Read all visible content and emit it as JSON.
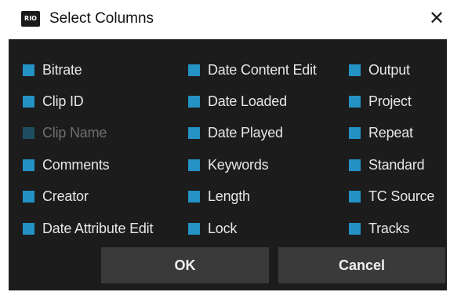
{
  "window": {
    "app_icon_text": "RIO",
    "title": "Select Columns",
    "close_glyph": "✕"
  },
  "colors": {
    "checkbox": "#2492c5",
    "checkbox_disabled": "#1e4d60",
    "background": "#1c1c1c",
    "button": "#3a3a3a"
  },
  "columns": [
    [
      {
        "label": "Bitrate",
        "checked": true,
        "enabled": true
      },
      {
        "label": "Clip ID",
        "checked": true,
        "enabled": true
      },
      {
        "label": "Clip Name",
        "checked": true,
        "enabled": false
      },
      {
        "label": "Comments",
        "checked": true,
        "enabled": true
      },
      {
        "label": "Creator",
        "checked": true,
        "enabled": true
      },
      {
        "label": "Date Attribute Edit",
        "checked": true,
        "enabled": true
      }
    ],
    [
      {
        "label": "Date Content Edit",
        "checked": true,
        "enabled": true
      },
      {
        "label": "Date Loaded",
        "checked": true,
        "enabled": true
      },
      {
        "label": "Date Played",
        "checked": true,
        "enabled": true
      },
      {
        "label": "Keywords",
        "checked": true,
        "enabled": true
      },
      {
        "label": "Length",
        "checked": true,
        "enabled": true
      },
      {
        "label": "Lock",
        "checked": true,
        "enabled": true
      }
    ],
    [
      {
        "label": "Output",
        "checked": true,
        "enabled": true
      },
      {
        "label": "Project",
        "checked": true,
        "enabled": true
      },
      {
        "label": "Repeat",
        "checked": true,
        "enabled": true
      },
      {
        "label": "Standard",
        "checked": true,
        "enabled": true
      },
      {
        "label": "TC Source",
        "checked": true,
        "enabled": true
      },
      {
        "label": "Tracks",
        "checked": true,
        "enabled": true
      }
    ]
  ],
  "buttons": {
    "ok": "OK",
    "cancel": "Cancel"
  }
}
